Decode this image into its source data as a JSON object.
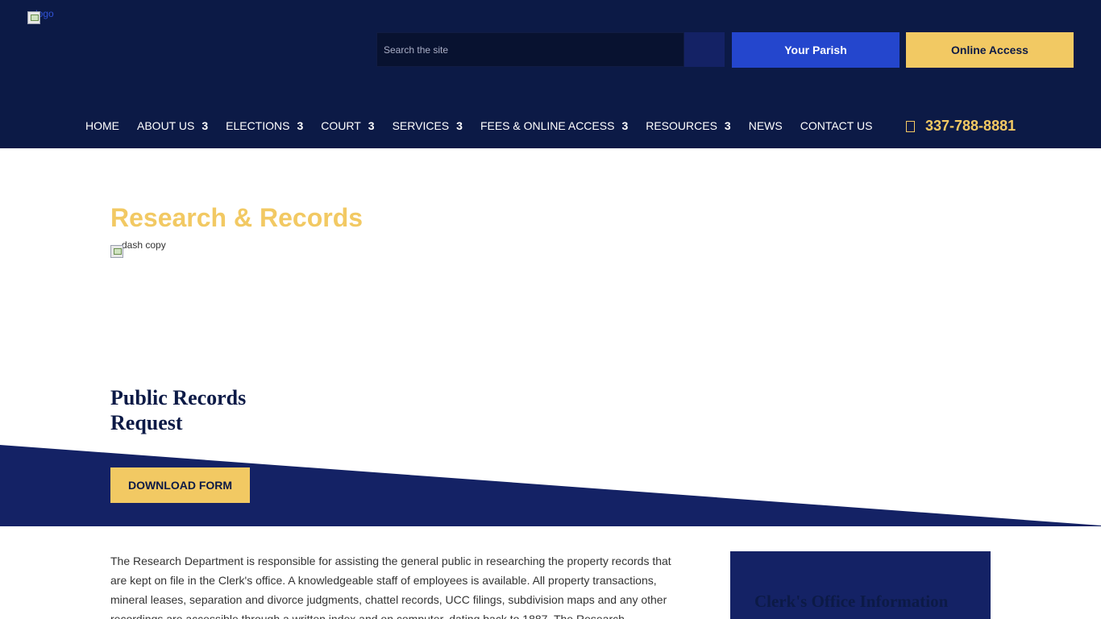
{
  "header": {
    "logo_alt": "logo",
    "search": {
      "placeholder": "Search the site"
    },
    "buttons": {
      "parish": "Your Parish",
      "online": "Online Access"
    },
    "nav": [
      {
        "label": "HOME",
        "has_dropdown": false
      },
      {
        "label": "ABOUT US",
        "has_dropdown": true
      },
      {
        "label": "ELECTIONS",
        "has_dropdown": true
      },
      {
        "label": "COURT",
        "has_dropdown": true
      },
      {
        "label": "SERVICES",
        "has_dropdown": true
      },
      {
        "label": "FEES & ONLINE ACCESS",
        "has_dropdown": true
      },
      {
        "label": "RESOURCES",
        "has_dropdown": true
      },
      {
        "label": "NEWS",
        "has_dropdown": false
      },
      {
        "label": "CONTACT US",
        "has_dropdown": false
      }
    ],
    "dropdown_glyph": "3",
    "phone": {
      "icon": "phone-icon",
      "number": "337-788-8881"
    }
  },
  "hero": {
    "title": "Research & Records",
    "dash_alt": "dash copy"
  },
  "public_records": {
    "title": "Public Records Request",
    "button": "DOWNLOAD FORM"
  },
  "body": {
    "paragraph": "The Research Department is responsible for assisting the general public in researching the property records that are kept on file in the Clerk's office. A knowledgeable staff of employees is available. All property transactions, mineral leases, separation and divorce judgments, chattel records, UCC filings, subdivision maps and any other recordings are accessible through a written index and on computer, dating back to 1887. The Research"
  },
  "sidebar": {
    "card_title": "Clerk's Office Information"
  },
  "colors": {
    "navy": "#0c1a46",
    "banner_blue": "#142265",
    "accent_gold": "#f2c963",
    "button_blue": "#2446cd"
  }
}
